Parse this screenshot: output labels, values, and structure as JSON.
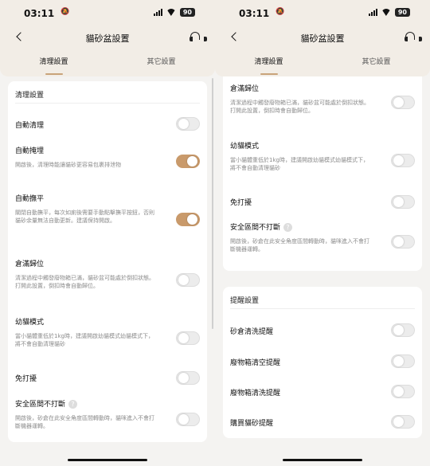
{
  "status_bar": {
    "time": "03:11",
    "mute_glyph": "🔕",
    "battery": "90"
  },
  "header": {
    "title": "貓砂盆設置"
  },
  "tabs": [
    {
      "label": "清理設置"
    },
    {
      "label": "其它設置"
    }
  ],
  "left": {
    "section_title": "清理設置",
    "rows": [
      {
        "label": "自動清理",
        "desc": "",
        "on": false
      },
      {
        "label": "自動掩埋",
        "desc": "開啟後，清理時能讓貓砂更容易包裹排泄物",
        "on": true
      },
      {
        "label": "自動撫平",
        "desc": "關閉自動撫平，每次如廁後需要手動點擊撫平按鈕，否則貓砂余量無法自動更新。建議保持開啟。",
        "on": true
      },
      {
        "label": "倉滿歸位",
        "desc": "清潔過程中觸發廢物箱已滿，貓砂盆可能處於倒扣狀態。打開此設置，倒扣時會自動歸位。",
        "on": false
      },
      {
        "label": "幼貓模式",
        "desc": "當小貓體重低於1kg時，建議開啟幼貓模式幼貓模式下，將不會自動清理貓砂",
        "on": false
      },
      {
        "label": "免打擾",
        "desc": "",
        "on": false
      },
      {
        "label": "安全區間不打斷",
        "desc": "開啟後，砂倉在此安全角度區間轉動時，貓咪進入不會打斷機器運轉。",
        "on": false,
        "info": "?"
      }
    ]
  },
  "right": {
    "top_rows": [
      {
        "label": "倉滿歸位",
        "desc": "清潔過程中觸發廢物箱已滿，貓砂盆可能處於倒扣狀態。打開此設置，倒扣時會自動歸位。",
        "on": false
      },
      {
        "label": "幼貓模式",
        "desc": "當小貓體重低於1kg時，建議開啟幼貓模式幼貓模式下，將不會自動清理貓砂",
        "on": false
      },
      {
        "label": "免打擾",
        "desc": "",
        "on": false
      },
      {
        "label": "安全區間不打斷",
        "desc": "開啟後，砂倉在此安全角度區間轉動時，貓咪進入不會打斷機器運轉。",
        "on": false,
        "info": "?"
      }
    ],
    "reminder_title": "提醒設置",
    "reminder_rows": [
      {
        "label": "砂倉清洗提醒",
        "on": false
      },
      {
        "label": "廢物箱清空提醒",
        "on": false
      },
      {
        "label": "廢物箱清洗提醒",
        "on": false
      },
      {
        "label": "購買貓砂提醒",
        "on": false
      }
    ]
  },
  "colors": {
    "accent": "#c99a6b",
    "header_bg": "#f2ede6",
    "page_bg": "#f4f3f1"
  }
}
